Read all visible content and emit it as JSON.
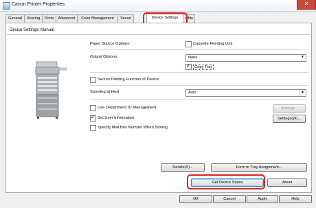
{
  "window": {
    "title": "Canon Printer Properties",
    "close_symbol": "✕"
  },
  "tabs": [
    {
      "label": "General"
    },
    {
      "label": "Sharing"
    },
    {
      "label": "Ports"
    },
    {
      "label": "Advanced"
    },
    {
      "label": "Color Management"
    },
    {
      "label": "Securi"
    },
    {
      "label": "Device Settings"
    },
    {
      "label": "rofile"
    }
  ],
  "panel": {
    "title": "Device Settings: Manual"
  },
  "settings": {
    "paper_source_label": "Paper Source Options:",
    "cassette_feeding_label": "Cassette Feeding Unit",
    "cassette_feeding_checked": false,
    "output_options_label": "Output Options:",
    "output_options_value": "None",
    "copy_tray_label": "Copy Tray",
    "copy_tray_checked": true,
    "secure_printing_label": "Secure Printing Function of Device",
    "secure_printing_checked": false,
    "spooling_label": "Spooling at Host",
    "spooling_value": "Auto",
    "dept_id_label": "Use Department ID Management",
    "dept_id_checked": false,
    "dept_settings_button": "Settings...",
    "user_info_label": "Set User Information",
    "user_info_checked": true,
    "user_settings_button": "Settings(W)...",
    "mailbox_label": "Specify Mail Box Number When Storing",
    "mailbox_checked": false
  },
  "panel_buttons": {
    "details": "Details(D)...",
    "form_to_tray": "Form to Tray Assignment...",
    "get_device_status": "Get Device Status",
    "about": "About"
  },
  "footer": {
    "ok": "OK",
    "cancel": "Cancel",
    "apply": "Apply",
    "help": "Help"
  },
  "annotation_color": "#e02020"
}
